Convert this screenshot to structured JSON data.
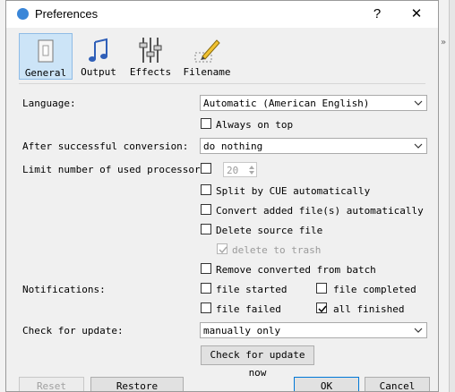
{
  "window": {
    "title": "Preferences",
    "help_label": "?",
    "close_label": "✕"
  },
  "toolbar": [
    {
      "label": "General",
      "icon": "switch-icon",
      "selected": true
    },
    {
      "label": "Output",
      "icon": "music-note-icon"
    },
    {
      "label": "Effects",
      "icon": "sliders-icon"
    },
    {
      "label": "Filename",
      "icon": "pencil-icon"
    }
  ],
  "general": {
    "language": {
      "label": "Language:",
      "value": "Automatic (American English)"
    },
    "always_on_top": {
      "label": "Always on top",
      "checked": false
    },
    "after_conversion": {
      "label": "After successful conversion:",
      "value": "do nothing"
    },
    "processors": {
      "label": "Limit number of used processors:",
      "checked": false,
      "value": "20"
    },
    "split_cue": {
      "label": "Split by CUE automatically",
      "checked": false
    },
    "convert_added": {
      "label": "Convert added file(s) automatically",
      "checked": false
    },
    "delete_source": {
      "label": "Delete source file",
      "checked": false
    },
    "delete_to_trash": {
      "label": "delete to trash",
      "checked": true,
      "enabled": false
    },
    "remove_converted": {
      "label": "Remove converted from batch",
      "checked": false
    },
    "notifications": {
      "label": "Notifications:",
      "file_started": {
        "label": "file started",
        "checked": false
      },
      "file_completed": {
        "label": "file completed",
        "checked": false
      },
      "file_failed": {
        "label": "file failed",
        "checked": false
      },
      "all_finished": {
        "label": "all finished",
        "checked": true
      }
    },
    "check_update": {
      "label": "Check for update:",
      "value": "manually only",
      "button": "Check for update now"
    }
  },
  "buttons": {
    "reset": "Reset",
    "restore_defaults": "Restore defaults",
    "ok": "OK",
    "cancel": "Cancel"
  },
  "colors": {
    "accent": "#0078d7",
    "selected_tab": "#cce4f7",
    "dialog_bg": "#f0f0f0"
  }
}
